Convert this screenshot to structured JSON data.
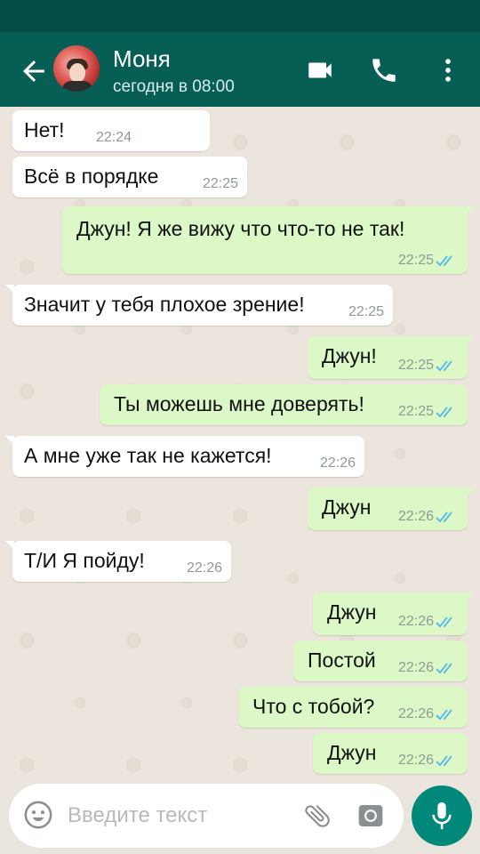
{
  "header": {
    "contact_name": "Моня",
    "status": "сегодня в 08:00",
    "colors": {
      "appbar": "#075e54",
      "statusbar": "#054d44"
    },
    "icons": [
      "back-arrow-icon",
      "video-call-icon",
      "phone-icon",
      "more-vert-icon"
    ]
  },
  "messages": [
    {
      "dir": "in",
      "text": "Нет!",
      "time": "22:24"
    },
    {
      "dir": "in",
      "text": "Всё в порядке",
      "time": "22:25"
    },
    {
      "dir": "out",
      "text": "Джун! Я же вижу что что-то не так!",
      "time": "22:25",
      "read": true
    },
    {
      "dir": "in",
      "text": "Значит у тебя плохое зрение!",
      "time": "22:25"
    },
    {
      "dir": "out",
      "text": "Джун!",
      "time": "22:25",
      "read": true
    },
    {
      "dir": "out",
      "text": "Ты можешь мне доверять!",
      "time": "22:25",
      "read": true
    },
    {
      "dir": "in",
      "text": "А мне уже так не кажется!",
      "time": "22:26"
    },
    {
      "dir": "out",
      "text": "Джун",
      "time": "22:26",
      "read": true
    },
    {
      "dir": "in",
      "text": "Т/И  Я пойду!",
      "time": "22:26"
    },
    {
      "dir": "out",
      "text": "Джун",
      "time": "22:26",
      "read": true
    },
    {
      "dir": "out",
      "text": "Постой",
      "time": "22:26",
      "read": true
    },
    {
      "dir": "out",
      "text": "Что с тобой?",
      "time": "22:26",
      "read": true
    },
    {
      "dir": "out",
      "text": "Джун",
      "time": "22:26",
      "read": true
    }
  ],
  "composer": {
    "placeholder": "Введите текст",
    "value": "",
    "icons": [
      "emoji-icon",
      "attach-icon",
      "camera-icon",
      "mic-icon"
    ],
    "mic_color": "#00897b"
  },
  "colors": {
    "bubble_in": "#ffffff",
    "bubble_out": "#dcf8c6",
    "read_ticks": "#4fb6ec",
    "chat_bg": "#ece5dd"
  }
}
